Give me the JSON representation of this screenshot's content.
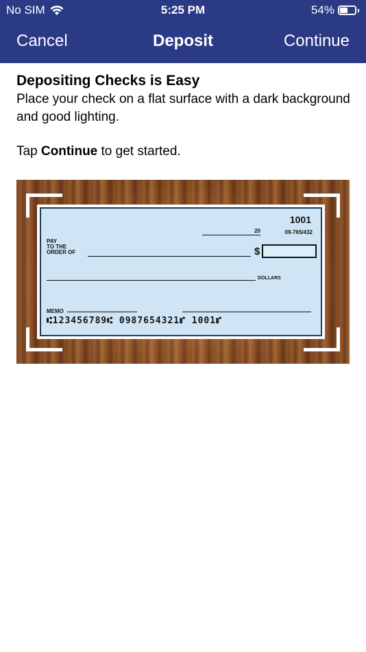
{
  "status_bar": {
    "carrier": "No SIM",
    "time": "5:25 PM",
    "battery_percent": "54%",
    "battery_level": 0.54
  },
  "nav": {
    "cancel_label": "Cancel",
    "title": "Deposit",
    "continue_label": "Continue"
  },
  "intro": {
    "heading": "Depositing Checks is Easy",
    "description": "Place your check on a flat surface with a dark background and good lighting.",
    "instruction_prefix": "Tap ",
    "instruction_bold": "Continue",
    "instruction_suffix": " to get started."
  },
  "check": {
    "number": "1001",
    "routing_fraction": "09-765/432",
    "date_prefix": "20",
    "pay_line1": "PAY",
    "pay_line2": "TO THE",
    "pay_line3": "ORDER OF",
    "dollar_sign": "$",
    "dollars_label": "DOLLARS",
    "memo_label": "MEMO",
    "micr_line": "⑆123456789⑆  0987654321⑈  1001⑈"
  },
  "colors": {
    "header_bg": "#2b3a84",
    "check_bg": "#cfe5f5"
  }
}
